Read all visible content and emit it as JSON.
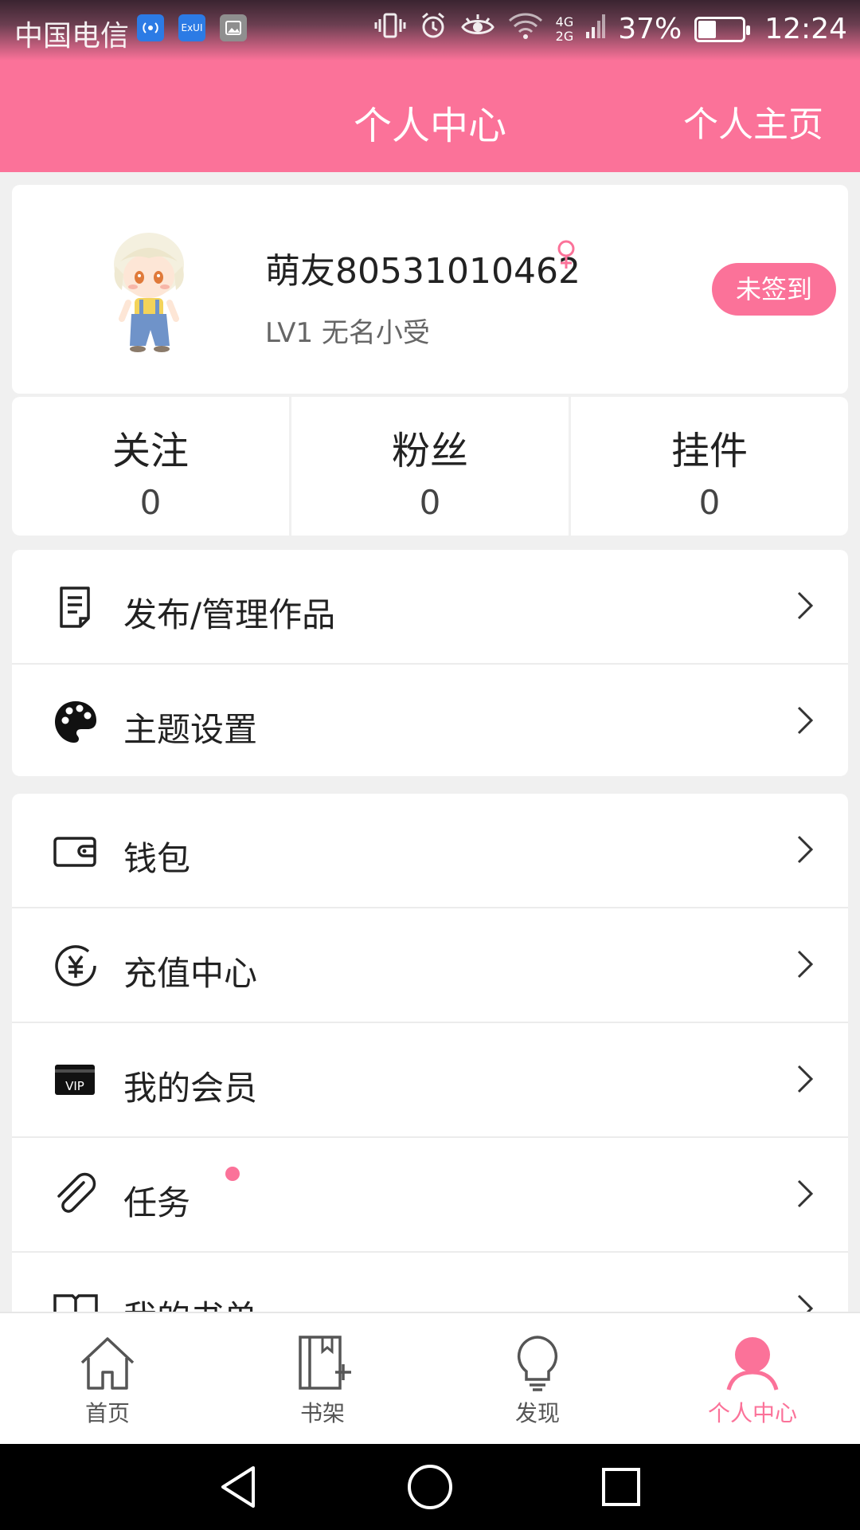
{
  "status_bar": {
    "carrier": "中国电信",
    "app_icon_2_label": "ExUI",
    "network": [
      "4G",
      "2G"
    ],
    "battery": "37%",
    "time": "12:24"
  },
  "app_bar": {
    "title": "个人中心",
    "right_link": "个人主页"
  },
  "profile": {
    "username": "萌友80531010462",
    "gender_icon": "female-icon",
    "level": "LV1",
    "title": "无名小受",
    "signin_label": "未签到",
    "level_line": "LV1  无名小受"
  },
  "stats": [
    {
      "label": "关注",
      "value": "0"
    },
    {
      "label": "粉丝",
      "value": "0"
    },
    {
      "label": "挂件",
      "value": "0"
    }
  ],
  "menu_group_1": [
    {
      "label": "发布/管理作品",
      "icon": "document-icon"
    },
    {
      "label": "主题设置",
      "icon": "palette-icon"
    }
  ],
  "menu_group_2": [
    {
      "label": "钱包",
      "icon": "wallet-icon"
    },
    {
      "label": "充值中心",
      "icon": "yen-icon"
    },
    {
      "label": "我的会员",
      "icon": "vip-icon",
      "icon_text": "VIP"
    },
    {
      "label": "任务",
      "icon": "paperclip-icon",
      "badge": "red-dot"
    },
    {
      "label": "我的书单",
      "icon": "book-icon"
    }
  ],
  "bottom_nav": [
    {
      "label": "首页",
      "icon": "home-icon"
    },
    {
      "label": "书架",
      "icon": "bookshelf-icon"
    },
    {
      "label": "发现",
      "icon": "lightbulb-icon"
    },
    {
      "label": "个人中心",
      "icon": "person-icon",
      "active": true
    }
  ],
  "colors": {
    "accent": "#fb7299",
    "background": "#f0f0f0",
    "card": "#ffffff"
  }
}
